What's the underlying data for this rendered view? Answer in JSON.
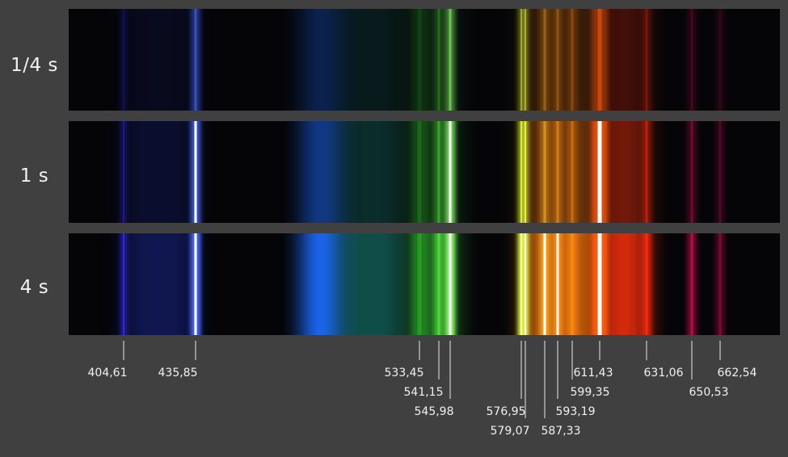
{
  "strips": [
    {
      "label": "1/4 s",
      "gain": 0.55
    },
    {
      "label": "1 s",
      "gain": 1.0
    },
    {
      "label": "4 s",
      "gain": 1.9
    }
  ],
  "lines": [
    {
      "wavelength": "404,61",
      "color": "#3a2cff",
      "strength": 0.35,
      "width": 2
    },
    {
      "wavelength": "435,85",
      "color": "#4a6bff",
      "strength": 1.0,
      "width": 3
    },
    {
      "wavelength": "533,45",
      "color": "#2fbf2a",
      "strength": 0.25,
      "width": 5
    },
    {
      "wavelength": "541,15",
      "color": "#4fe03a",
      "strength": 0.45,
      "width": 3
    },
    {
      "wavelength": "545,98",
      "color": "#8cff6a",
      "strength": 1.0,
      "width": 3
    },
    {
      "wavelength": "576,95",
      "color": "#d6ff3a",
      "strength": 0.8,
      "width": 2
    },
    {
      "wavelength": "579,07",
      "color": "#f2ff40",
      "strength": 0.8,
      "width": 2
    },
    {
      "wavelength": "587,33",
      "color": "#ffb020",
      "strength": 0.55,
      "width": 3
    },
    {
      "wavelength": "593,19",
      "color": "#ff9a1a",
      "strength": 0.5,
      "width": 3
    },
    {
      "wavelength": "599,35",
      "color": "#ff8a15",
      "strength": 0.45,
      "width": 3
    },
    {
      "wavelength": "611,43",
      "color": "#ff5a10",
      "strength": 1.0,
      "width": 5
    },
    {
      "wavelength": "631,06",
      "color": "#ff2a10",
      "strength": 0.45,
      "width": 3
    },
    {
      "wavelength": "650,53",
      "color": "#d01050",
      "strength": 0.35,
      "width": 3
    },
    {
      "wavelength": "662,54",
      "color": "#a01040",
      "strength": 0.3,
      "width": 3
    }
  ],
  "bands": [
    {
      "color": "#1a2aa0",
      "strength": 0.25
    },
    {
      "color": "#1e6cff",
      "strength": 0.55
    },
    {
      "color": "#1fa090",
      "strength": 0.25
    },
    {
      "color": "#2a9a2a",
      "strength": 0.35
    },
    {
      "color": "#ff7a10",
      "strength": 0.4
    },
    {
      "color": "#ff3010",
      "strength": 0.45
    }
  ]
}
